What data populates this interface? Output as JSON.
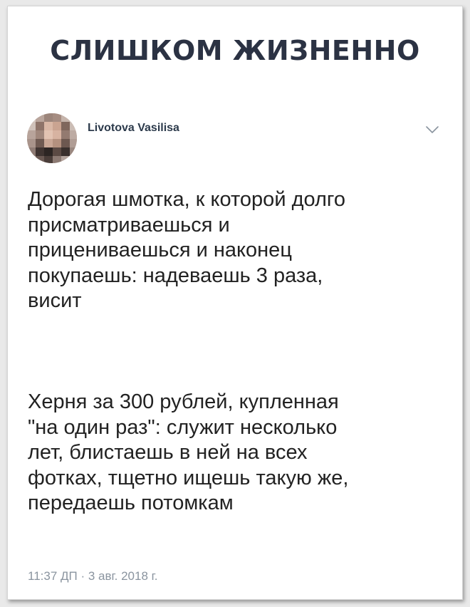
{
  "headline": "СЛИШКОМ ЖИЗНЕННО",
  "tweet": {
    "author_name": "Livotova Vasilisa",
    "avatar_icon": "blurred-profile-photo-icon",
    "menu_icon": "chevron-down-icon",
    "paragraph_1": "Дорогая шмотка, к которой долго\nприсматриваешься и\nприцениваешься и наконец\nпокупаешь: надеваешь 3 раза,\nвисит",
    "paragraph_2": "Херня за 300 рублей, купленная\n\"на один раз\": служит несколько\nлет, блистаешь в ней на всех\nфотках, тщетно ищешь такую же,\nпередаешь потомкам",
    "timestamp": "11:37 ДП · 3 авг. 2018 г."
  },
  "colors": {
    "headline": "#2b3243",
    "body_text": "#222222",
    "timestamp": "#8a949f",
    "chevron": "#8a949f",
    "background": "#ffffff"
  }
}
